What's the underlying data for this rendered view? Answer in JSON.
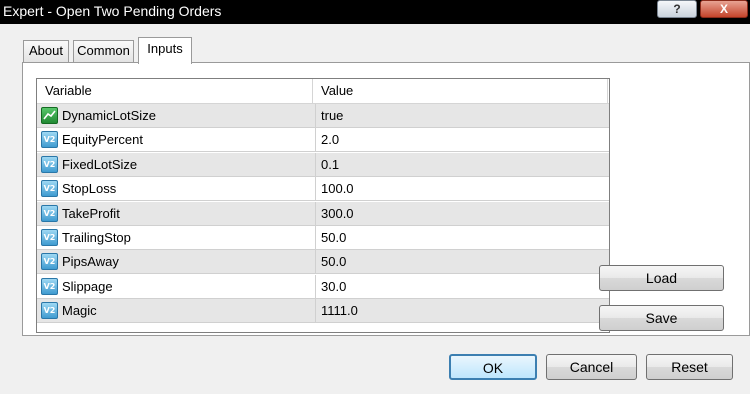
{
  "window": {
    "title": "Expert - Open Two Pending Orders",
    "help_label": "?",
    "close_label": "X"
  },
  "tabs": [
    {
      "label": "About",
      "active": false
    },
    {
      "label": "Common",
      "active": false
    },
    {
      "label": "Inputs",
      "active": true
    }
  ],
  "grid": {
    "columns": [
      "Variable",
      "Value"
    ],
    "rows": [
      {
        "name": "DynamicLotSize",
        "value": "true",
        "icon": "boolean-icon"
      },
      {
        "name": "EquityPercent",
        "value": "2.0",
        "icon": "number-icon"
      },
      {
        "name": "FixedLotSize",
        "value": "0.1",
        "icon": "number-icon"
      },
      {
        "name": "StopLoss",
        "value": "100.0",
        "icon": "number-icon"
      },
      {
        "name": "TakeProfit",
        "value": "300.0",
        "icon": "number-icon"
      },
      {
        "name": "TrailingStop",
        "value": "50.0",
        "icon": "number-icon"
      },
      {
        "name": "PipsAway",
        "value": "50.0",
        "icon": "number-icon"
      },
      {
        "name": "Slippage",
        "value": "30.0",
        "icon": "number-icon"
      },
      {
        "name": "Magic",
        "value": "1111.0",
        "icon": "number-icon"
      }
    ]
  },
  "buttons": {
    "load": "Load",
    "save": "Save",
    "ok": "OK",
    "cancel": "Cancel",
    "reset": "Reset"
  }
}
